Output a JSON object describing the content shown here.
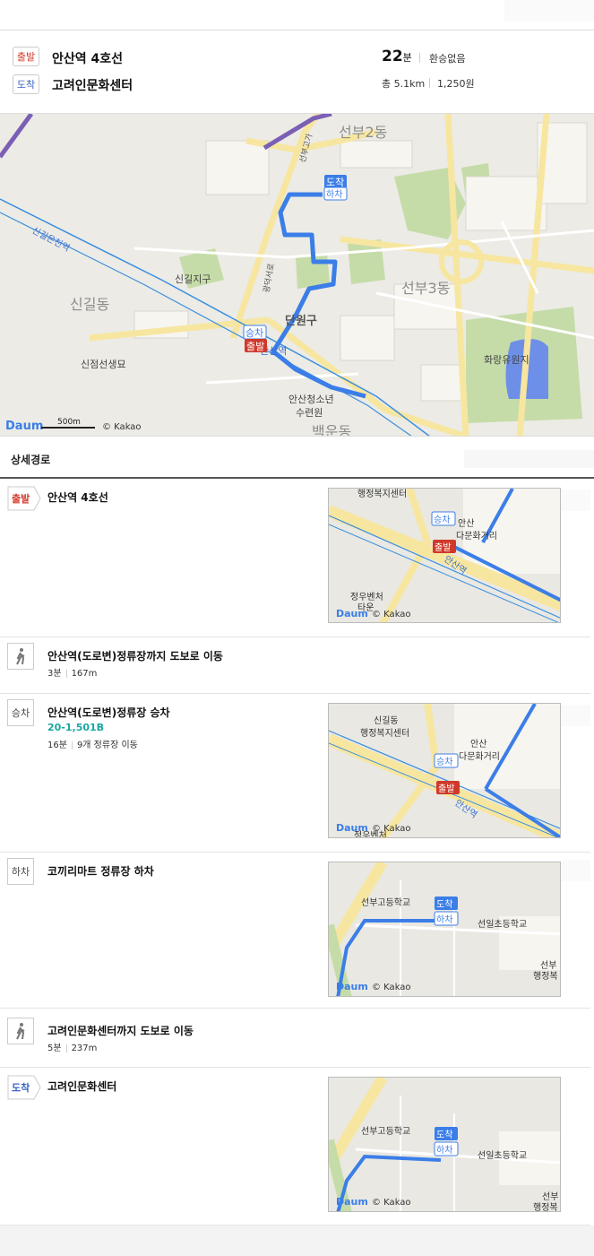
{
  "summary": {
    "start_tag": "출발",
    "end_tag": "도착",
    "start_name": "안산역 4호선",
    "end_name": "고려인문화센터",
    "time_value": "22",
    "time_unit": "분",
    "transfer": "환승없음",
    "distance": "총 5.1km",
    "fare": "1,250원"
  },
  "map": {
    "labels": {
      "seonbu2": "선부2동",
      "singil_dong": "신길동",
      "singil_jigu": "신길지구",
      "wonsan": "신길온천역",
      "danwon": "단원구",
      "seonbu3": "선부3동",
      "cemetery": "신점선생묘",
      "hwarang": "화랑유원지",
      "youth": "안산청소년",
      "youth2": "수련원",
      "baek": "백운동",
      "ansan": "안산역",
      "road1": "선부고가",
      "road2": "광덕서로"
    },
    "markers": {
      "arrive": "도착",
      "alight": "하차",
      "board": "승차",
      "depart": "출발"
    },
    "logo": "Daum",
    "copyright": "© Kakao",
    "scale": "500m",
    "colors": {
      "route": "#3b7ee8",
      "rail": "#3a8fe0",
      "subway_purple": "#7b5fb5"
    }
  },
  "detail": {
    "heading": "상세경로",
    "steps": [
      {
        "icon": "depart",
        "tag": "출발",
        "title": "안산역 4호선"
      },
      {
        "icon": "walk-icon",
        "title": "안산역(도로변)정류장까지 도보로 이동",
        "time": "3분",
        "dist": "167m"
      },
      {
        "icon": "board",
        "tag": "승차",
        "title": "안산역(도로변)정류장 승차",
        "route": "20-1,501B",
        "time": "16분",
        "stops": "9개 정류장 이동"
      },
      {
        "icon": "alight",
        "tag": "하차",
        "title": "코끼리마트 정류장 하차"
      },
      {
        "icon": "walk-icon",
        "title": "고려인문화센터까지 도보로 이동",
        "time": "5분",
        "dist": "237m"
      },
      {
        "icon": "arrive",
        "tag": "도착",
        "title": "고려인문화센터"
      }
    ],
    "thumb1": {
      "t1": "행정복지센터",
      "t2": "안산",
      "t3": "다문화거리",
      "t4": "정우벤처",
      "t5": "타운",
      "t6": "안산역",
      "m1": "승차",
      "m2": "출발"
    },
    "thumb2": {
      "t1": "신길동",
      "t2": "행정복지센터",
      "t3": "안산",
      "t4": "다문화거리",
      "t5": "안산역",
      "t6": "정우벤처",
      "m1": "승차",
      "m2": "출발"
    },
    "thumb3": {
      "t1": "선부고등학교",
      "t2": "선일초등학교",
      "t3": "선부",
      "t4": "행정복",
      "m1": "도착",
      "m2": "하차"
    },
    "thumb4": {
      "t1": "선부고등학교",
      "t2": "선일초등학교",
      "t3": "선부",
      "t4": "행정복",
      "m1": "도착",
      "m2": "하차"
    }
  }
}
